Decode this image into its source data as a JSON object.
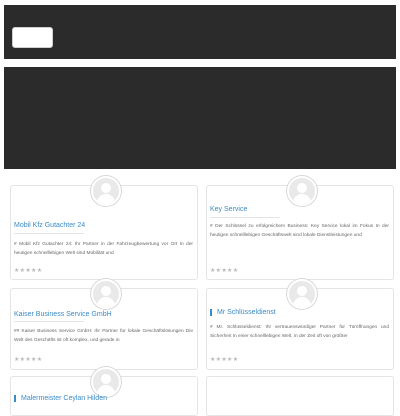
{
  "header": {
    "button_label": ""
  },
  "cards": [
    {
      "title": "Mobil Kfz Gutachter 24",
      "description": "# Mobil Kfz Gutachter 24: Ihr Partner in der Fahrzeugbewertung vor Ort In der heutigen schnelllebigen Welt sind Mobilität und",
      "rating": "★★★★★"
    },
    {
      "title": "Key Service",
      "description": "# Der Schlüssel zu erfolgreichem Business: Key Service lokal im Fokus In der heutigen schnelllebigen Geschäftswelt sind lokale Dienstleistungen und",
      "rating": "★★★★★"
    },
    {
      "title": "Kaiser Business Service GmbH",
      "description": "## Kaiser Business Service GmbH: Ihr Partner für lokale Geschäftslösungen Die Welt des Geschäfts ist oft komplex, und gerade in",
      "rating": "★★★★★"
    },
    {
      "title": "Mr Schlüsseldienst",
      "description": "# Mr. Schlüsseldienst: Ihr vertrauenswürdiger Partner für Türöffnungen und Sicherheit In einer schnelllebigen Welt, in der Zeit oft von größter",
      "rating": "★★★★★"
    },
    {
      "title": "Malermeister Ceylan Hilden",
      "description": "",
      "rating": ""
    }
  ]
}
